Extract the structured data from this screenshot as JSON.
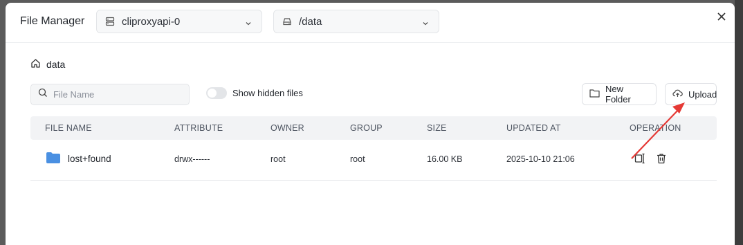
{
  "modal": {
    "title": "File Manager",
    "server_select": {
      "value": "cliproxyapi-0",
      "icon": "server-icon"
    },
    "path_select": {
      "value": "/data",
      "icon": "drive-icon"
    }
  },
  "breadcrumb": {
    "label": "data",
    "icon": "home-icon"
  },
  "search": {
    "placeholder": "File Name",
    "value": ""
  },
  "hidden_files_toggle": {
    "label": "Show hidden files",
    "on": false
  },
  "actions": {
    "new_folder": "New Folder",
    "upload": "Upload"
  },
  "table": {
    "columns": [
      "FILE NAME",
      "ATTRIBUTE",
      "OWNER",
      "GROUP",
      "SIZE",
      "UPDATED AT",
      "OPERATION"
    ],
    "rows": [
      {
        "name": "lost+found",
        "attribute": "drwx------",
        "owner": "root",
        "group": "root",
        "size": "16.00 KB",
        "updated_at": "2025-10-10 21:06"
      }
    ]
  },
  "colors": {
    "accent": "#4a90e2",
    "annotation_arrow": "#e53935",
    "folder": "#4a90e2"
  }
}
